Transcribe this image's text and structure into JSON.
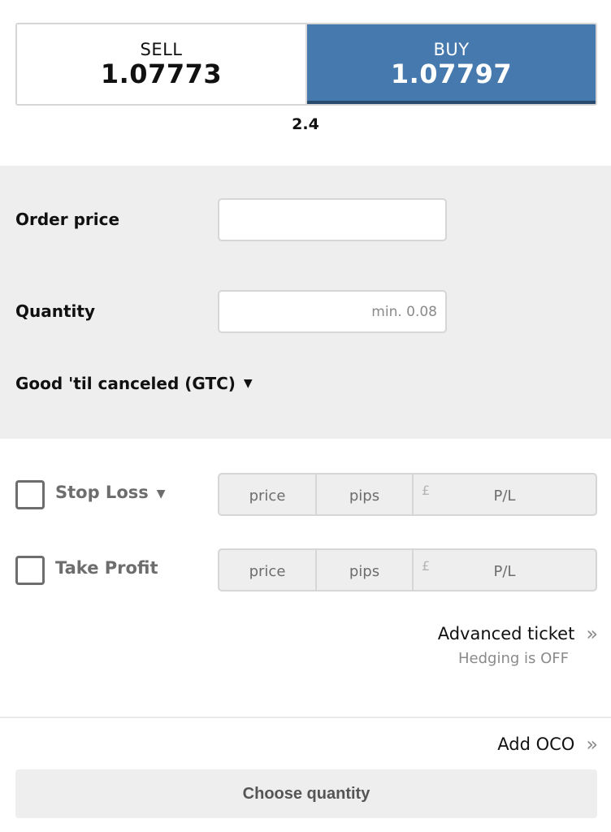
{
  "trade": {
    "sell": {
      "label": "SELL",
      "price": "1.07773"
    },
    "buy": {
      "label": "BUY",
      "price": "1.07797"
    },
    "spread": "2.4"
  },
  "colors": {
    "buy_bg": "#4679ad",
    "buy_border": "#274a6e",
    "panel_bg": "#eeeeee"
  },
  "order": {
    "price_label": "Order price",
    "price_value": "",
    "price_placeholder": "",
    "quantity_label": "Quantity",
    "quantity_value": "",
    "quantity_placeholder": "min. 0.08",
    "duration_selected": "Good 'til canceled (GTC)",
    "duration_caret": "▼"
  },
  "stop_loss": {
    "label": "Stop Loss",
    "checked": false,
    "caret": "▼",
    "price": "price",
    "pips": "pips",
    "currency": "£",
    "pl": "P/L"
  },
  "take_profit": {
    "label": "Take Profit",
    "checked": false,
    "price": "price",
    "pips": "pips",
    "currency": "£",
    "pl": "P/L"
  },
  "advanced": {
    "label": "Advanced ticket",
    "chevron": "»",
    "hedging": "Hedging is OFF"
  },
  "oco": {
    "label": "Add OCO",
    "chevron": "»"
  },
  "submit": {
    "label": "Choose quantity"
  }
}
